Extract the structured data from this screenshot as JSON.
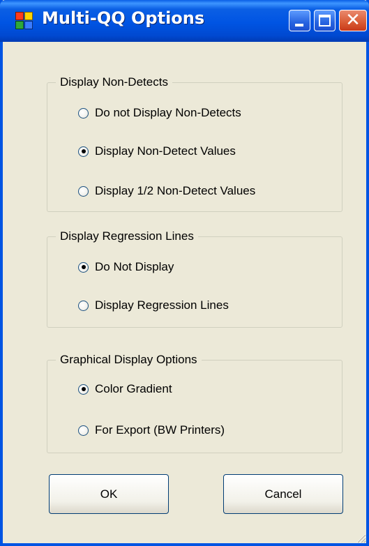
{
  "window": {
    "title": "Multi-QQ Options",
    "app_icon": "options-app-icon",
    "controls": [
      "minimize-icon",
      "maximize-icon",
      "close-icon"
    ],
    "close_glyph": "✕",
    "accent_color": "#0054e3",
    "close_color": "#d95a33"
  },
  "groups": {
    "non_detects": {
      "title": "Display Non-Detects",
      "options": [
        {
          "label": "Do not Display Non-Detects",
          "checked": false
        },
        {
          "label": "Display Non-Detect Values",
          "checked": true
        },
        {
          "label": "Display 1/2 Non-Detect Values",
          "checked": false
        }
      ]
    },
    "regression": {
      "title": "Display Regression Lines",
      "options": [
        {
          "label": "Do Not Display",
          "checked": true
        },
        {
          "label": "Display Regression Lines",
          "checked": false
        }
      ]
    },
    "graphical": {
      "title": "Graphical Display Options",
      "options": [
        {
          "label": "Color Gradient",
          "checked": true
        },
        {
          "label": "For Export (BW Printers)",
          "checked": false
        }
      ]
    }
  },
  "buttons": {
    "ok_label": "OK",
    "cancel_label": "Cancel"
  }
}
